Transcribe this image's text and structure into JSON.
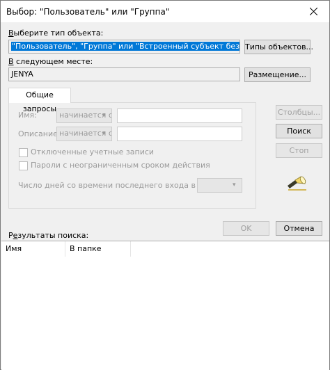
{
  "window": {
    "title": "Выбор: \"Пользователь\" или \"Группа\""
  },
  "object_type": {
    "label": "Выберите тип объекта:",
    "value": "\"Пользователь\", \"Группа\" или \"Встроенный субъект безопасности\"",
    "button": "Типы объектов..."
  },
  "location": {
    "label": "В следующем месте:",
    "value": "JENYA",
    "button": "Размещение..."
  },
  "tab": {
    "label": "Общие запросы"
  },
  "query": {
    "name_label": "Имя:",
    "name_operator": "начинается с",
    "description_label": "Описание:",
    "description_operator": "начинается с",
    "disabled_accounts_label": "Отключенные учетные записи",
    "non_expiring_passwords_label": "Пароли с неограниченным сроком действия",
    "days_since_login_label": "Число дней со времени последнего входа в систему:"
  },
  "side_buttons": {
    "columns": "Столбцы...",
    "search": "Поиск",
    "stop": "Стоп"
  },
  "footer_buttons": {
    "ok": "OK",
    "cancel": "Отмена"
  },
  "results": {
    "label": "Результаты поиска:",
    "columns": [
      "Имя",
      "В папке"
    ]
  },
  "icons": {
    "close": "close-icon",
    "search_flashlight": "flashlight-icon",
    "dropdown": "chevron-down-icon"
  }
}
